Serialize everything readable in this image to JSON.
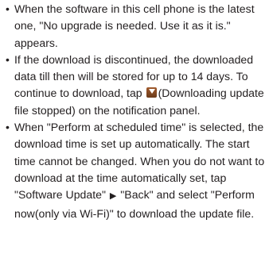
{
  "bullet_symbol": "•",
  "notes": [
    {
      "text": "When the software in this cell phone is the latest one, \"No upgrade is needed. Use it as it is.\" appears."
    },
    {
      "before_icon": "If the download is discontinued, the downloaded data till then will be stored for up to 14 days. To continue to download, tap ",
      "icon": "download-stopped-icon",
      "after_icon": "(Downloading update file stopped) on the notification panel."
    },
    {
      "before_arrow": "When \"Perform at scheduled time\" is selected, the download time is set up automatically. The start time cannot be changed. When you do not want to download at the time automatically set, tap \"Software Update\" ",
      "arrow": "▶",
      "after_arrow": " \"Back\" and select \"Perform now(only via Wi-Fi)\" to download the update file."
    }
  ]
}
